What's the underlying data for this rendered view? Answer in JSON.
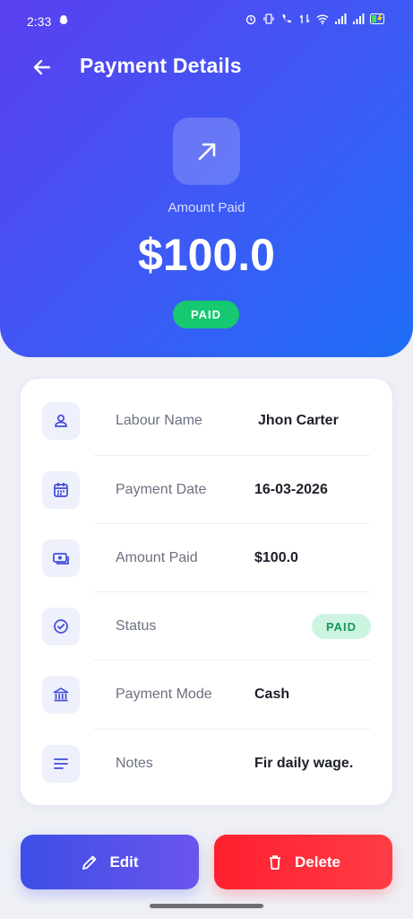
{
  "status_bar": {
    "time": "2:33"
  },
  "header": {
    "title": "Payment Details",
    "amount_label": "Amount Paid",
    "amount": "$100.0",
    "status_pill": "PAID"
  },
  "details": [
    {
      "label": "Labour Name",
      "value": "Jhon Carter",
      "icon": "user-icon"
    },
    {
      "label": "Payment Date",
      "value": "16-03-2026",
      "icon": "calendar-icon"
    },
    {
      "label": "Amount Paid",
      "value": "$100.0",
      "icon": "cash-icon"
    },
    {
      "label": "Status",
      "value": "PAID",
      "icon": "check-circle-icon"
    },
    {
      "label": "Payment Mode",
      "value": "Cash",
      "icon": "bank-icon"
    },
    {
      "label": "Notes",
      "value": "Fir daily wage.",
      "icon": "notes-icon"
    }
  ],
  "actions": {
    "edit_label": "Edit",
    "delete_label": "Delete"
  },
  "colors": {
    "header_start": "#5a3ff0",
    "header_end": "#1e6ef6",
    "paid_green": "#16c86f",
    "delete_red": "#ff1f2f",
    "edit_blue": "#3d4ee6"
  }
}
